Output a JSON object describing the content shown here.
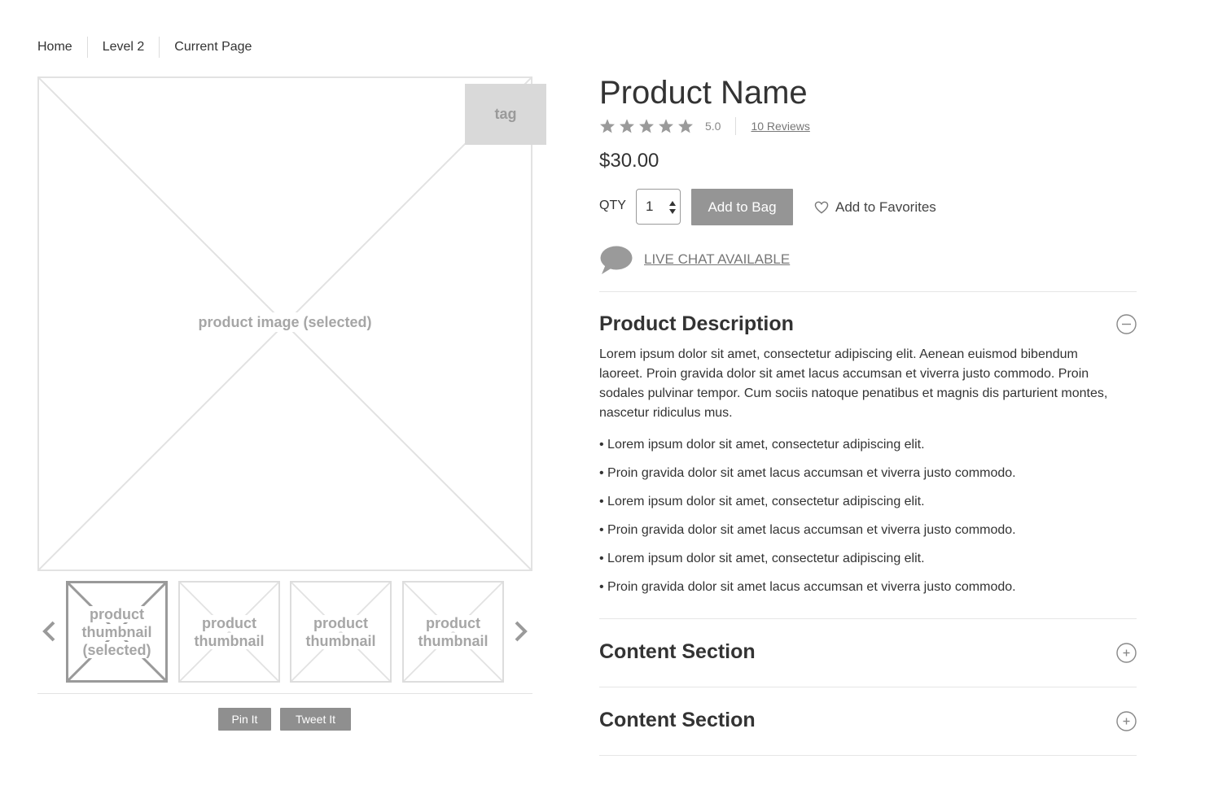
{
  "breadcrumb": [
    "Home",
    "Level 2",
    "Current Page"
  ],
  "gallery": {
    "main_image_label": "product image (selected)",
    "tag_label": "tag",
    "thumbnails": [
      {
        "label": "product thumbnail (selected)",
        "selected": true
      },
      {
        "label": "product thumbnail",
        "selected": false
      },
      {
        "label": "product thumbnail",
        "selected": false
      },
      {
        "label": "product thumbnail",
        "selected": false
      }
    ],
    "prev_icon": "chevron-left-icon",
    "next_icon": "chevron-right-icon"
  },
  "social": {
    "pin_label": "Pin It",
    "tweet_label": "Tweet It"
  },
  "product": {
    "name": "Product Name",
    "rating": 5.0,
    "rating_text": "5.0",
    "stars": 5,
    "reviews_label": "10 Reviews",
    "price": "$30.00",
    "qty_label": "QTY",
    "qty_value": "1",
    "add_to_bag_label": "Add to Bag",
    "favorites_label": "Add to Favorites",
    "live_chat_label": "LIVE CHAT AVAILABLE"
  },
  "description": {
    "title": "Product Description",
    "expanded": true,
    "paragraph": "Lorem ipsum dolor sit amet, consectetur adipiscing elit. Aenean euismod bibendum laoreet. Proin gravida dolor sit amet lacus accumsan et viverra justo commodo. Proin sodales pulvinar tempor. Cum sociis natoque penatibus et magnis dis parturient montes, nascetur ridiculus mus.",
    "bullets": [
      "• Lorem ipsum dolor sit amet, consectetur adipiscing elit.",
      "• Proin gravida dolor sit amet lacus accumsan et viverra justo commodo.",
      "• Lorem ipsum dolor sit amet, consectetur adipiscing elit.",
      "• Proin gravida dolor sit amet lacus accumsan et viverra justo commodo.",
      "• Lorem ipsum dolor sit amet, consectetur adipiscing elit.",
      "• Proin gravida dolor sit amet lacus accumsan et viverra justo commodo."
    ]
  },
  "sections": [
    {
      "title": "Content Section",
      "expanded": false
    },
    {
      "title": "Content Section",
      "expanded": false
    }
  ],
  "colors": {
    "button_gray": "#959595",
    "placeholder_gray": "#a6a6a6",
    "border_gray": "#e2e2e2",
    "text_dark": "#333333"
  }
}
